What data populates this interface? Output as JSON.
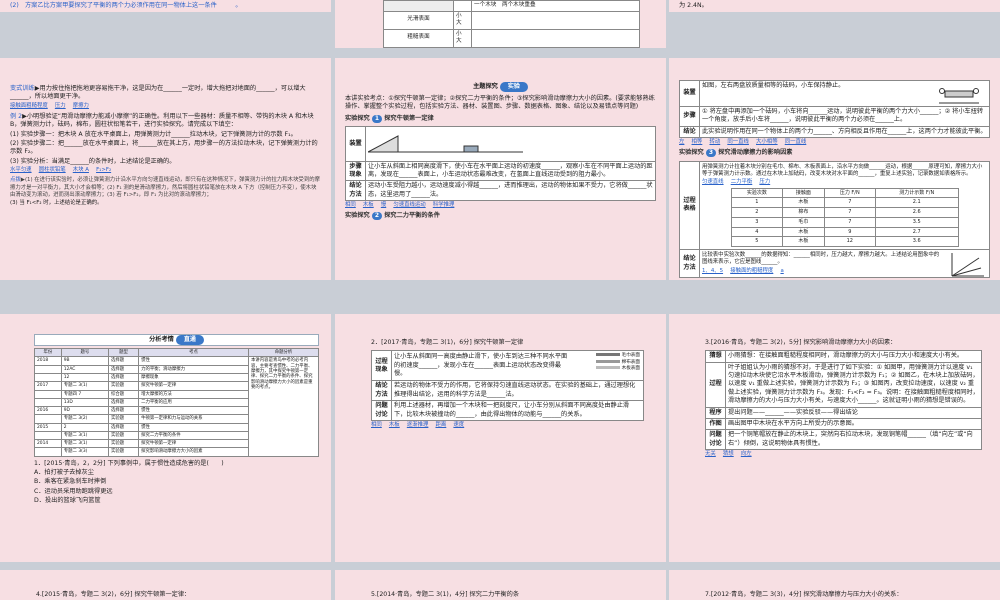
{
  "s1": {
    "line": "(2)　方案乙比方案甲要探究了平衡的两个力必须作用在同一物体上这一条件　　　。"
  },
  "s2": {
    "header_cell": "一个木块　两个木块重叠",
    "rows": [
      {
        "surface": "光滑表面",
        "cells": [
          "小",
          "大"
        ]
      },
      {
        "surface": "粗糙表面",
        "cells": [
          "小",
          "大"
        ]
      }
    ]
  },
  "s3": {
    "line": "为 2.4N。"
  },
  "s4": {
    "variant_label": "变式训练",
    "variant_text": "▶用力按住拖把拖地更容易拖干净，这是因为在______一定时，增大拖把对地面的______，可以增大______，所以地面更干净。",
    "variant_answers": [
      "接触面粗糙程度",
      "压力",
      "摩擦力"
    ],
    "ex_label": "例 2",
    "ex_text": "▶小明想验证“用滑动摩擦力能减小摩擦”的正确性。利用以下一些器材：质量不相等、带钩的木块 A 和木块 B，弹簧测力计，砝码，棉布，圆柱状铅笔若干，进行实验探究。请完成以下填空：",
    "steps": [
      "(1) 实验步骤一：把木块 A 放在水平桌面上，用弹簧测力计______拉动木块，记下弹簧测力计的示数 F₁。",
      "(2) 实验步骤二：把______放在水平桌面上，将______放在其上方，用步骤一的方法拉动木块，记下弹簧测力计的示数 F₂。",
      "(3) 实验分析：当满足______的条件时，上述结论是正确的。"
    ],
    "step_answers": [
      "水平匀速",
      "圆柱状铅笔",
      "木块 A",
      "F₁>F₂"
    ],
    "tip_label": "点拨",
    "tip_text": "▶(1) 在进行该实验时，必须让弹簧测力计沿水平方向匀速直线运动，即只有在这种情况下，弹簧测力计的拉力和木块受到的摩擦力才是一对平衡力，其大小才会相等；(2) F₁ 测的是滑动摩擦力，然后将圆柱状铅笔放在木块 A 下方（控制压力不变），使木块由滑动变为滚动，进而测出滚动摩擦力；(3) 若 F₁>F₂，即 F₁ 为比对的滚动摩擦力；",
    "tip_end": "(3) 当 F₁<F₂ 时，上述结论是正确的。"
  },
  "s5": {
    "banner": "主题探究",
    "banner_tag": "实验",
    "intro": "本讲实验考点：①探究牛顿第一定律；②探究二力平衡的条件；③探究影响滑动摩擦力大小的因素。(要求能够熟练操作、掌握整个实验过程，包括实验方法、器材、装置图、步骤、数据表格、图象、结论以及易错点等问题)",
    "exp1_label": "实验探究",
    "exp1_num": "1",
    "exp1_title": "探究牛顿第一定律",
    "rows": [
      {
        "label": "装置",
        "text": ""
      },
      {
        "label": "步骤现象",
        "text": "让小车从斜面上相同高度滑下，使小车在水平面上运动的初速度______，观察小车在不同平面上运动的距离，发现在______表面上，小车运动状态最难改变，在氢面上直线运动受到的阻力最小。"
      },
      {
        "label": "结论方法",
        "text": "运动小车受阻力越小，运动速度减小得越______，进而推理出，运动的物体如果不受力，它将做______状态，这里运用了______法。"
      }
    ],
    "answers": [
      "相同",
      "木板",
      "慢",
      "匀速直线运动",
      "科学推理"
    ],
    "exp2_label": "实验探究",
    "exp2_num": "2",
    "exp2_title": "探究二力平衡的条件"
  },
  "s6": {
    "rows": [
      {
        "label": "装置",
        "text": "如图，左右两盘放质量相等的砝码，小车保持静止。"
      },
      {
        "label": "步骤",
        "text": "① 将左盘中再添加一个砝码，小车将向______运动，说明彼此平衡的两个力大小______；② 将小车扭转一个角度，放手后小车将______，说明彼此平衡的两个力必须在______上。"
      },
      {
        "label": "结论",
        "text": "此实验说明作用在同一个物体上的两个力______、方向相反且作用在______上，这两个力才能彼此平衡。"
      }
    ],
    "answers": [
      "左",
      "相等",
      "转动",
      "同一直线",
      "大小相等",
      "同一直线"
    ],
    "exp3_label": "实验探究",
    "exp3_num": "3",
    "exp3_title": "探究滑动摩擦力的影响因素",
    "proc_label": "过程表格",
    "proc_text": "用弹簧测力计拉着木块分别在毛巾、棉布、木板表面上，沿水平方向做______运动，根据______原理可知，摩擦力大小等于弹簧测力计示数。通过在木块上加砝码，改变木块对水平面的______，重复上述实验，记录数据如表格所示。",
    "proc_answers": [
      "匀速直线",
      "二力平衡",
      "压力"
    ],
    "table_headers": [
      "实验次数",
      "接触面",
      "压力 F/N",
      "测力计示数 F/N"
    ],
    "table_rows": [
      [
        "1",
        "木板",
        "7",
        "2.1"
      ],
      [
        "2",
        "棉布",
        "7",
        "2.6"
      ],
      [
        "3",
        "毛巾",
        "7",
        "3.5"
      ],
      [
        "4",
        "木板",
        "9",
        "2.7"
      ],
      [
        "5",
        "木板",
        "12",
        "3.6"
      ]
    ],
    "conc_label": "结论方法",
    "conc_text": "比较表中实验次数______的数据得知：______相同时，压力越大，摩擦力越大。上述结论用图象中的图线来表示，它应是图线______。",
    "conc_answers": [
      "1、4、5",
      "接触面的粗糙程度",
      "a"
    ]
  },
  "s7": {
    "banner": "分析考情",
    "banner_tag": "直通",
    "table_headers": [
      "年份",
      "题号",
      "题型",
      "考点",
      "命题分析"
    ],
    "table_rows": [
      [
        "2018",
        "9B",
        "选择题",
        "惯性",
        ""
      ],
      [
        "",
        "12AC",
        "选择题",
        "力的平衡；滑动摩擦力",
        ""
      ],
      [
        "",
        "12",
        "选择题",
        "摩擦现象",
        ""
      ],
      [
        "2017",
        "专题二 3(1)",
        "实验题",
        "探究牛顿第一定律",
        ""
      ],
      [
        "",
        "专题四 7",
        "综合题",
        "增大摩擦的方法",
        ""
      ],
      [
        "",
        "13D",
        "选择题",
        "二力平衡的应用",
        ""
      ],
      [
        "2016",
        "9D",
        "选择题",
        "惯性",
        ""
      ],
      [
        "",
        "专题二 3(2)",
        "实验题",
        "牛顿第一定律和力与运动的关系",
        ""
      ],
      [
        "2015",
        "2",
        "选择题",
        "惯性",
        ""
      ],
      [
        "",
        "专题二 3(1)",
        "实验题",
        "探究二力平衡的条件",
        ""
      ],
      [
        "2014",
        "专题二 3(1)",
        "实验题",
        "探究牛顿第一定律",
        ""
      ],
      [
        "",
        "专题二 3(3)",
        "实验题",
        "探究影响滑动摩擦力大小的因素",
        ""
      ]
    ],
    "analysis": "本讲内容是青岛中考的必考内容，主要考查惯性、二力平衡、摩擦力，其中探究牛顿第一定律、探究二力平衡的条件、探究影响滑动摩擦力大小的因素是重要的考点。",
    "q_num": "1．",
    "q_text": "[2015·青岛，2，2分] 下列事例中，属于惯性造成危害的是(　　)",
    "options": [
      "A．拍打被子去掉灰尘",
      "B．乘客在紧急刹车时摔倒",
      "C．运动员采用助跑跳得更远",
      "D．投出的篮球飞向篮筐"
    ]
  },
  "s8": {
    "q_title": "2．[2017·青岛，专题二 3(1)，6分] 探究牛顿第一定律",
    "rows": [
      {
        "label": "过程现象",
        "text": "让小车从斜面同一高度由静止滑下，使小车到达三种不同水平面的初速度______，发现小车在______表面上运动状态改变得最慢。"
      },
      {
        "label": "结论方法",
        "text": "若运动的物体不受力的作用，它将保持匀速直线运动状态。在实验的基础上，通过理想化推理得出结论，运用的科学方法是______法。"
      },
      {
        "label": "问题讨论",
        "text": "利用上述器材，再增加一个木块和一把刻度尺，让小车分别从斜面不同高度处由静止滑下，比较木块被撞动的______，由此得出物体的动能与______的关系。"
      }
    ],
    "answers": [
      "相同",
      "木板",
      "逐渐推理",
      "距离",
      "速度"
    ],
    "legend": [
      "毛巾表面",
      "棉布表面",
      "木板表面"
    ]
  },
  "s9": {
    "q_title": "3.[2016·青岛，专题二 3(2)，5分] 探究影响滑动摩擦力大小的因素：",
    "rows": [
      {
        "label": "猜想",
        "text": "小雨猜想：在接触面粗糙程度相同时，滑动摩擦力的大小与压力大小和速度大小有关。"
      },
      {
        "label": "过程",
        "text": "叶子姐姐认为小雨的猜想不对，于是进行了如下实验：① 如图甲，用弹簧测力计以速度 v₁ 匀速拉动木块使它沿水平木板滑动，弹簧测力计示数为 F₁；② 如图乙，在木块上加放砝码，以速度 v₁ 重做上述实验，弹簧测力计示数为 F₂；③ 如图丙，改变拉动速度，以速度 v₂ 重做上述实验，弹簧测力计示数为 F₃。发现：F₁<F₂ = F₃。说明：在接触面粗糙程度相同时，滑动摩擦力的大小与压力大小有关，与速度大小______。这就证明小雨的猜想是错误的。"
      },
      {
        "label": "程序",
        "text": "提出问题——______——实验反驳——得出结论"
      },
      {
        "label": "作图",
        "text": "画出图甲中木块在水平方向上所受力的示意图。"
      },
      {
        "label": "问题讨论",
        "text": "把一个铜笔帽放在静止的木块上，突然向右拉动木块，发现铜笔帽______（填“向左”或“向右”）倾倒，这说明物体具有惯性。"
      }
    ],
    "answers": [
      "无关",
      "猜想",
      "向左"
    ]
  },
  "s10": {
    "line": "4.[2015·青岛，专题二 3(2)，6分] 探究牛顿第一定律："
  },
  "s11": {
    "line": "5.[2014·青岛，专题二 3(1)，4分] 探究二力平衡的条"
  },
  "s12": {
    "line": "7.[2012·青岛，专题二 3(3)，4分] 探究滑动摩擦力与压力大小的关系："
  }
}
